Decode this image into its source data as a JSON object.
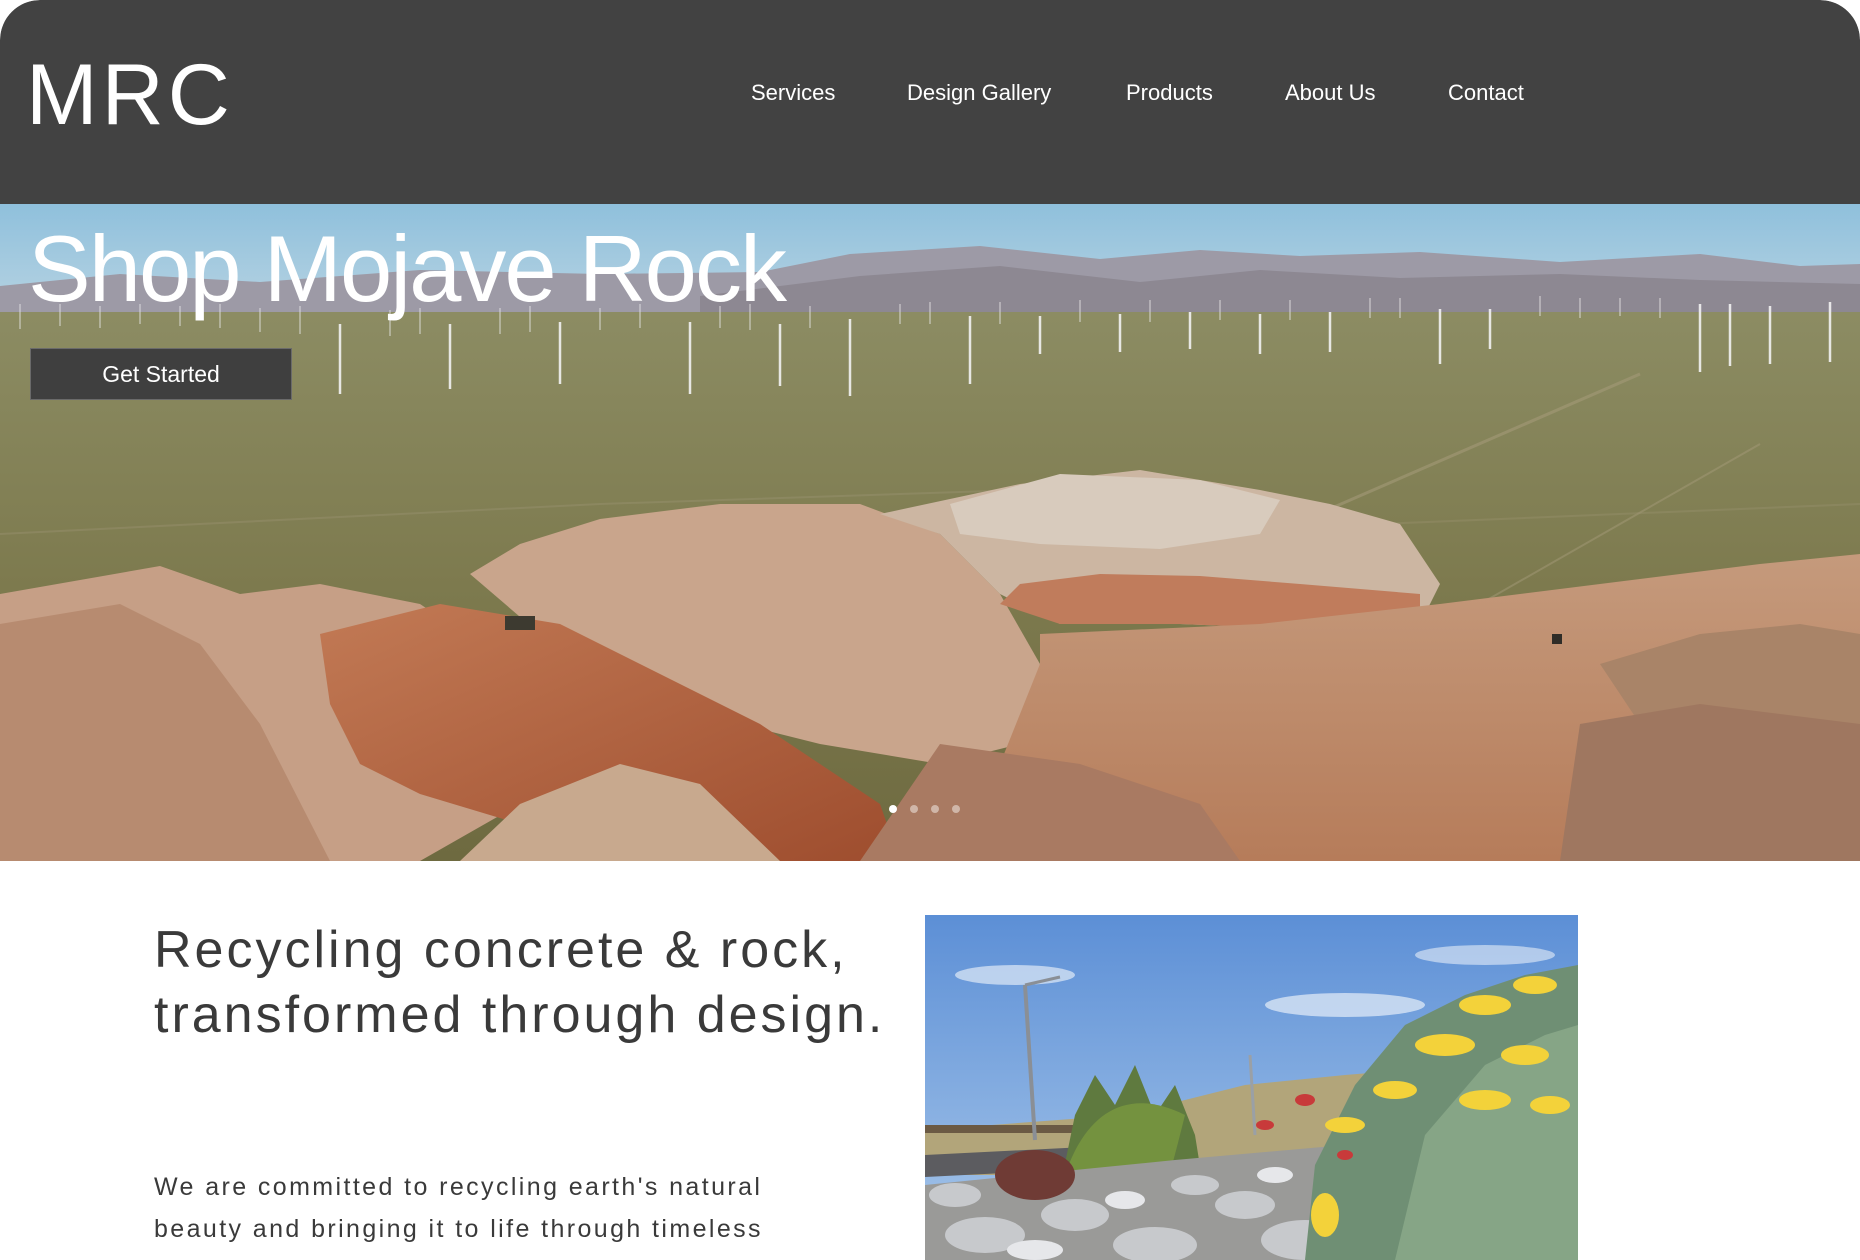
{
  "header": {
    "logo": "MRC",
    "nav": [
      {
        "label": "Services"
      },
      {
        "label": "Design Gallery"
      },
      {
        "label": "Products"
      },
      {
        "label": "About Us"
      },
      {
        "label": "Contact"
      }
    ]
  },
  "hero": {
    "title": "Shop Mojave Rock",
    "button_label": "Get Started",
    "slideshow": {
      "slides": 4,
      "active": 1
    }
  },
  "intro": {
    "heading": "Recycling concrete & rock, transformed through design.",
    "body": "We are committed to recycling earth's natural beauty and bringing it to life through timeless design."
  },
  "colors": {
    "header_bg": "#424242",
    "text_dark": "#3a3a3a",
    "button_bg": "#3f3f3f"
  }
}
